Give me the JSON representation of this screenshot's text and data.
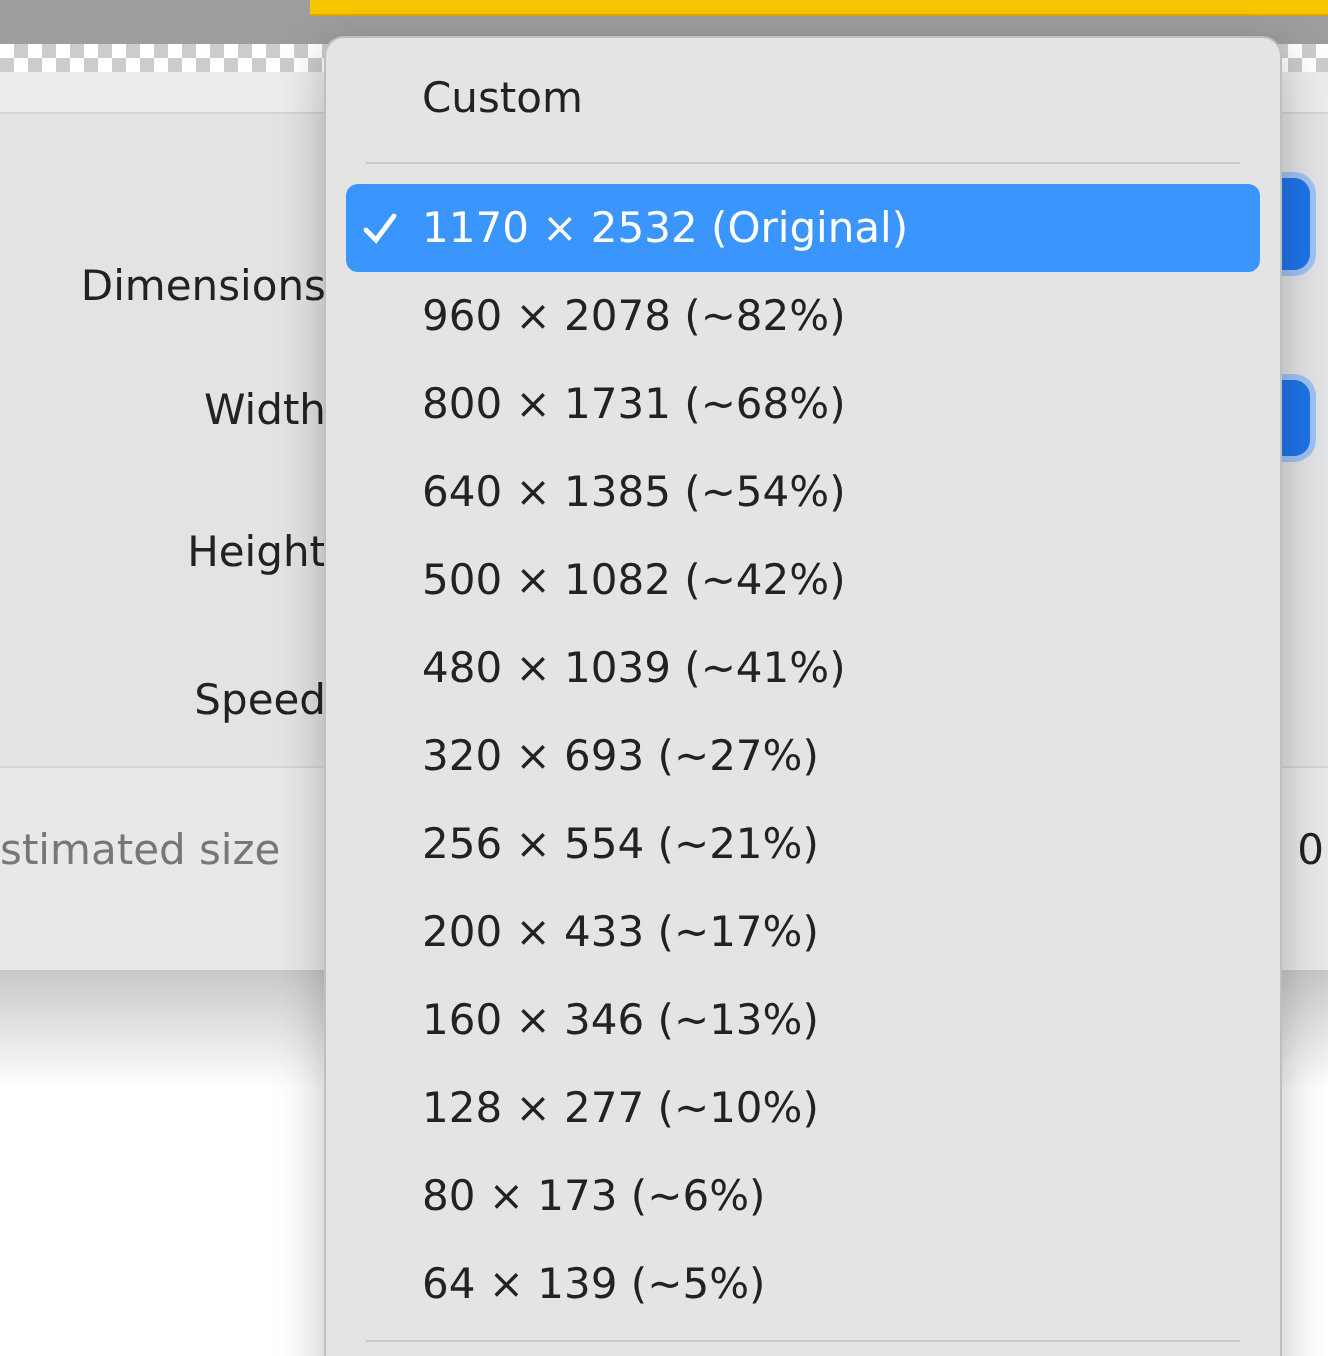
{
  "dialog": {
    "labels": [
      {
        "kind": "dimensions",
        "text": "Dimensions"
      },
      {
        "kind": "width",
        "text": "Width"
      },
      {
        "kind": "height",
        "text": "Height"
      },
      {
        "kind": "speed",
        "text": "Speed"
      }
    ],
    "estimated_size": {
      "label": "stimated size",
      "value": "0"
    }
  },
  "menu": {
    "header": "Custom",
    "items": [
      {
        "label": "1170 × 2532 (Original)",
        "selected": true
      },
      {
        "label": "960 × 2078 (~82%)",
        "selected": false
      },
      {
        "label": "800 × 1731 (~68%)",
        "selected": false
      },
      {
        "label": "640 × 1385 (~54%)",
        "selected": false
      },
      {
        "label": "500 × 1082 (~42%)",
        "selected": false
      },
      {
        "label": "480 × 1039 (~41%)",
        "selected": false
      },
      {
        "label": "320 × 693 (~27%)",
        "selected": false
      },
      {
        "label": "256 × 554 (~21%)",
        "selected": false
      },
      {
        "label": "200 × 433 (~17%)",
        "selected": false
      },
      {
        "label": "160 × 346 (~13%)",
        "selected": false
      },
      {
        "label": "128 × 277 (~10%)",
        "selected": false
      },
      {
        "label": "80 × 173 (~6%)",
        "selected": false
      },
      {
        "label": "64 × 139 (~5%)",
        "selected": false
      }
    ]
  }
}
